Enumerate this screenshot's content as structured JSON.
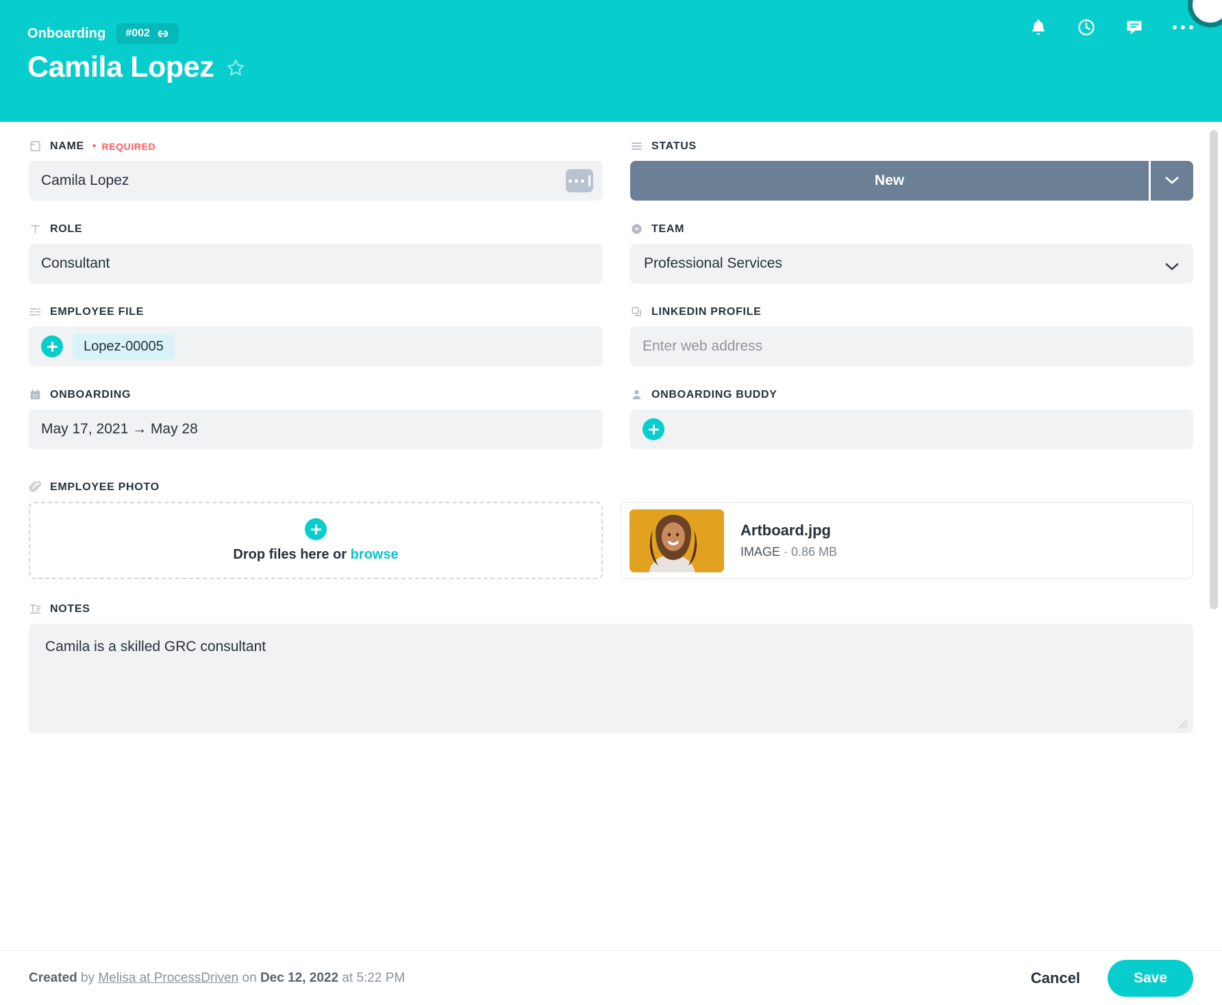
{
  "header": {
    "breadcrumb": "Onboarding",
    "record_id": "#002",
    "title": "Camila Lopez",
    "icons": [
      "bell-icon",
      "clock-icon",
      "comment-icon",
      "more-horizontal-icon"
    ]
  },
  "fields": {
    "name": {
      "label": "NAME",
      "required_text": "REQUIRED",
      "value": "Camila Lopez",
      "icon": "card-icon"
    },
    "status": {
      "label": "STATUS",
      "value": "New",
      "icon": "list-icon",
      "color": "#6b7f95"
    },
    "role": {
      "label": "ROLE",
      "value": "Consultant",
      "icon": "text-icon"
    },
    "team": {
      "label": "TEAM",
      "value": "Professional Services",
      "icon": "dropdown-icon"
    },
    "employee_file": {
      "label": "EMPLOYEE FILE",
      "tag": "Lopez-00005",
      "icon": "relation-icon"
    },
    "linkedin": {
      "label": "LINKEDIN PROFILE",
      "placeholder": "Enter web address",
      "value": "",
      "icon": "link-field-icon"
    },
    "onboarding": {
      "label": "ONBOARDING",
      "value": "May 17, 2021 → May 28",
      "icon": "calendar-icon"
    },
    "onboarding_buddy": {
      "label": "ONBOARDING BUDDY",
      "value": "",
      "icon": "person-icon"
    },
    "employee_photo": {
      "label": "EMPLOYEE PHOTO",
      "icon": "paperclip-icon",
      "dropzone_text": "Drop files here or ",
      "dropzone_link": "browse",
      "file": {
        "name": "Artboard.jpg",
        "type": "IMAGE",
        "separator": " · ",
        "size": "0.86 MB"
      }
    },
    "notes": {
      "label": "NOTES",
      "value": "Camila is a skilled GRC consultant",
      "icon": "text-block-icon"
    }
  },
  "footer": {
    "created_word": "Created",
    "by_word": "by",
    "author": "Melisa at ProcessDriven",
    "on_word": "on",
    "date": "Dec 12, 2022",
    "at_word": "at",
    "time": "5:22 PM",
    "cancel_label": "Cancel",
    "save_label": "Save"
  },
  "theme": {
    "accent": "#07CDCD",
    "status": "#6b7f95",
    "required": "#ff5a5a",
    "field_bg": "#f1f2f3"
  }
}
